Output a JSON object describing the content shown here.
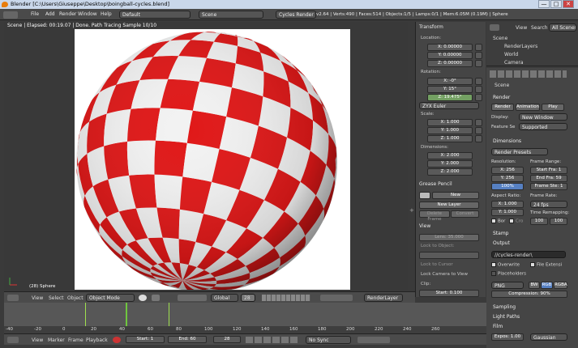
{
  "window": {
    "title": "Blender [C:\\Users\\Giuseppe\\Desktop\\boingball-cycles.blend]",
    "min": "—",
    "max": "□",
    "close": "✕"
  },
  "menu": {
    "items": [
      "File",
      "Add",
      "Render",
      "Window",
      "Help"
    ],
    "layout": "Default",
    "scene": "Scene",
    "engine": "Cycles Render",
    "info": "v2.64 | Verts:490 | Faces:514 | Objects:1/5 | Lamps:0/1 | Mem:6.05M (0.19M) | Sphere"
  },
  "viewport": {
    "status": "Scene | Elapsed: 00:19.07 | Done. Path Tracing Sample 10/10",
    "object_label": "(28) Sphere",
    "header": {
      "items": [
        "View",
        "Select",
        "Object"
      ],
      "mode": "Object Mode",
      "orientation": "Global",
      "layer_field": "28",
      "render_layer": "RenderLayer"
    }
  },
  "tools": {
    "transform": "Transform",
    "location": "Location:",
    "loc": [
      "X: 0.00000",
      "Y: 0.00000",
      "Z: 0.00000"
    ],
    "rotation": "Rotation:",
    "rot": [
      "X: -0°",
      "Y: 15°",
      "Z: 19.475°"
    ],
    "rot_mode": "ZYX Euler",
    "scale": "Scale:",
    "scl": [
      "X: 1.000",
      "Y: 1.000",
      "Z: 1.000"
    ],
    "dimensions": "Dimensions:",
    "dim": [
      "X: 2.000",
      "Y: 2.000",
      "Z: 2.000"
    ],
    "grease": "Grease Pencil",
    "new": "New",
    "new_layer": "New Layer",
    "delete_frame": "Delete Frame",
    "convert": "Convert",
    "view": "View",
    "lens": "Lens: 35.000",
    "lock_object": "Lock to Object:",
    "lock_cursor": "Lock to Cursor",
    "lock_camera": "Lock Camera to View",
    "clip": "Clip:",
    "clip_start": "Start: 0.100"
  },
  "outliner": {
    "view": "View",
    "search": "Search",
    "all_scenes": "All Scenes",
    "items": [
      "Scene",
      "RenderLayers",
      "World",
      "Camera"
    ]
  },
  "props": {
    "scene": "Scene",
    "render": "Render",
    "render_btn": "Render",
    "anim_btn": "Animation",
    "play_btn": "Play",
    "display_label": "Display:",
    "display_val": "New Window",
    "feature_label": "Feature Se",
    "feature_val": "Supported",
    "dimensions": "Dimensions",
    "presets": "Render Presets",
    "resolution": "Resolution:",
    "res_x": "X: 256",
    "res_y": "Y: 256",
    "res_pct": "100%",
    "frame_range": "Frame Range:",
    "start": "Start Fra: 1",
    "end": "End Fra: 59",
    "step": "Frame Ste: 1",
    "aspect": "Aspect Ratio:",
    "asp_x": "X: 1.000",
    "asp_y": "Y: 1.000",
    "bor": "Bor",
    "cro": "Cro",
    "frame_rate": "Frame Rate:",
    "fps": "24 fps",
    "remap": "Time Remapping:",
    "remap_old": "100",
    "remap_new": "100",
    "stamp": "Stamp",
    "output": "Output",
    "path": "//cycles-render\\",
    "overwrite": "Overwrite",
    "file_ext": "File Extensi",
    "placeholders": "Placeholders",
    "format": "PNG",
    "bw": "BW",
    "rgb": "RGB",
    "rgba": "RGBA",
    "compression": "Compression: 90%",
    "sampling": "Sampling",
    "light_paths": "Light Paths",
    "film": "Film",
    "exposure": "Expos: 1.00",
    "filter": "Gaussian"
  },
  "timeline": {
    "ruler": [
      "-40",
      "-20",
      "0",
      "20",
      "40",
      "60",
      "80",
      "100",
      "120",
      "140",
      "160",
      "180",
      "200",
      "220",
      "240",
      "260"
    ],
    "items": [
      "View",
      "Marker",
      "Frame",
      "Playback"
    ],
    "start": "Start: 1",
    "end": "End: 60",
    "current": "28",
    "sync": "No Sync"
  },
  "colors": {
    "red": "#e01818",
    "white": "#f2f2f2",
    "accent": "#5680c2"
  },
  "sphere": {
    "rows": 12,
    "cols": 12
  }
}
